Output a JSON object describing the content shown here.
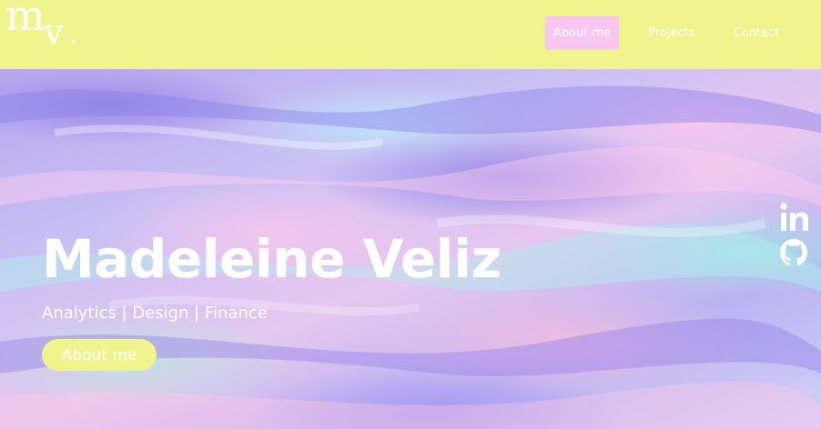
{
  "brand": {
    "logo_m": "m",
    "logo_v": "v",
    "logo_dot": "."
  },
  "nav": {
    "items": [
      {
        "label": "About me",
        "active": true
      },
      {
        "label": "Projects",
        "active": false
      },
      {
        "label": "Contact",
        "active": false
      }
    ]
  },
  "hero": {
    "title": "Madeleine Veliz",
    "subtitle": "Analytics | Design | Finance",
    "cta_label": "About me"
  },
  "social": {
    "icons": [
      "linkedin-icon",
      "github-icon"
    ]
  },
  "colors": {
    "navbar_bg": "#eff48c",
    "active_nav_bg": "#f8c6f1",
    "cta_bg": "#eff48c",
    "text": "#ffffff"
  }
}
